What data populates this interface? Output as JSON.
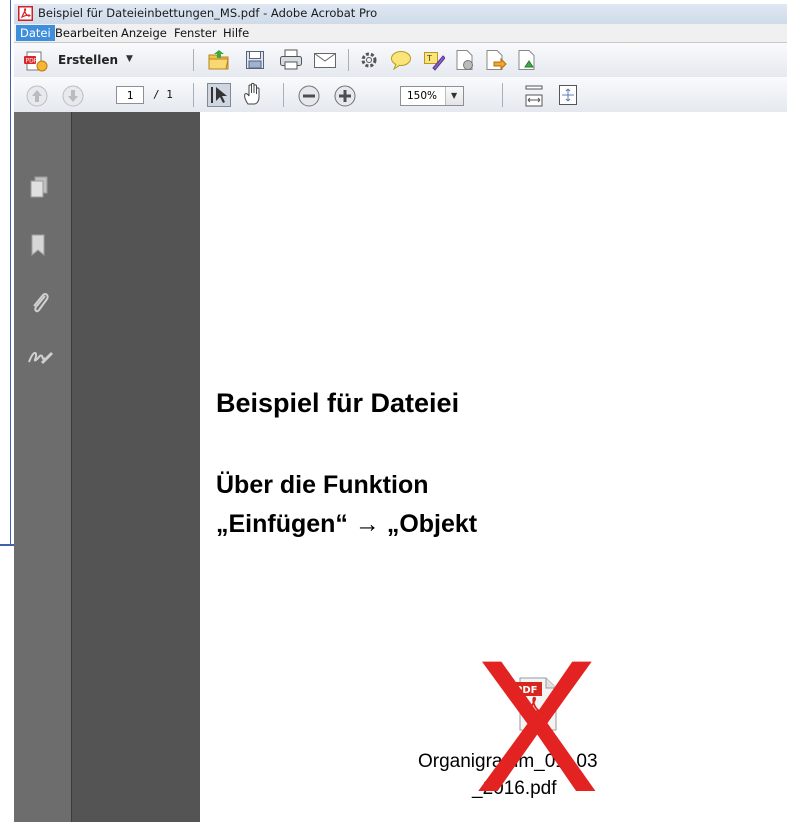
{
  "window": {
    "title": "Beispiel für Dateieinbettungen_MS.pdf - Adobe Acrobat Pro"
  },
  "menu": [
    {
      "label": "Datei",
      "active": true
    },
    {
      "label": "Bearbeiten",
      "active": false
    },
    {
      "label": "Anzeige",
      "active": false
    },
    {
      "label": "Fenster",
      "active": false
    },
    {
      "label": "Hilfe",
      "active": false
    }
  ],
  "toolbar": {
    "create_label": "Erstellen",
    "icons": [
      "open-folder-icon",
      "save-icon",
      "print-icon",
      "email-icon",
      "settings-icon",
      "comment-icon",
      "sign-icon",
      "security-icon",
      "export-icon",
      "combine-icon"
    ]
  },
  "nav": {
    "page_current": "1",
    "page_total": "/ 1",
    "zoom": "150%"
  },
  "sidebar": {
    "icons": [
      "pages-icon",
      "bookmark-icon",
      "attachment-icon",
      "signature-icon"
    ]
  },
  "document": {
    "heading": "Beispiel für Dateiei",
    "subheading_line1": "Über die Funktion",
    "subheading_line2": "„Einfügen“ → „Objekt",
    "attachment_icon_label": "PDF",
    "attachment_name_line1": "Organigramm_01_03",
    "attachment_name_line2": "_2016.pdf",
    "overlay_mark": "X",
    "overlay_color": "#e32222"
  }
}
